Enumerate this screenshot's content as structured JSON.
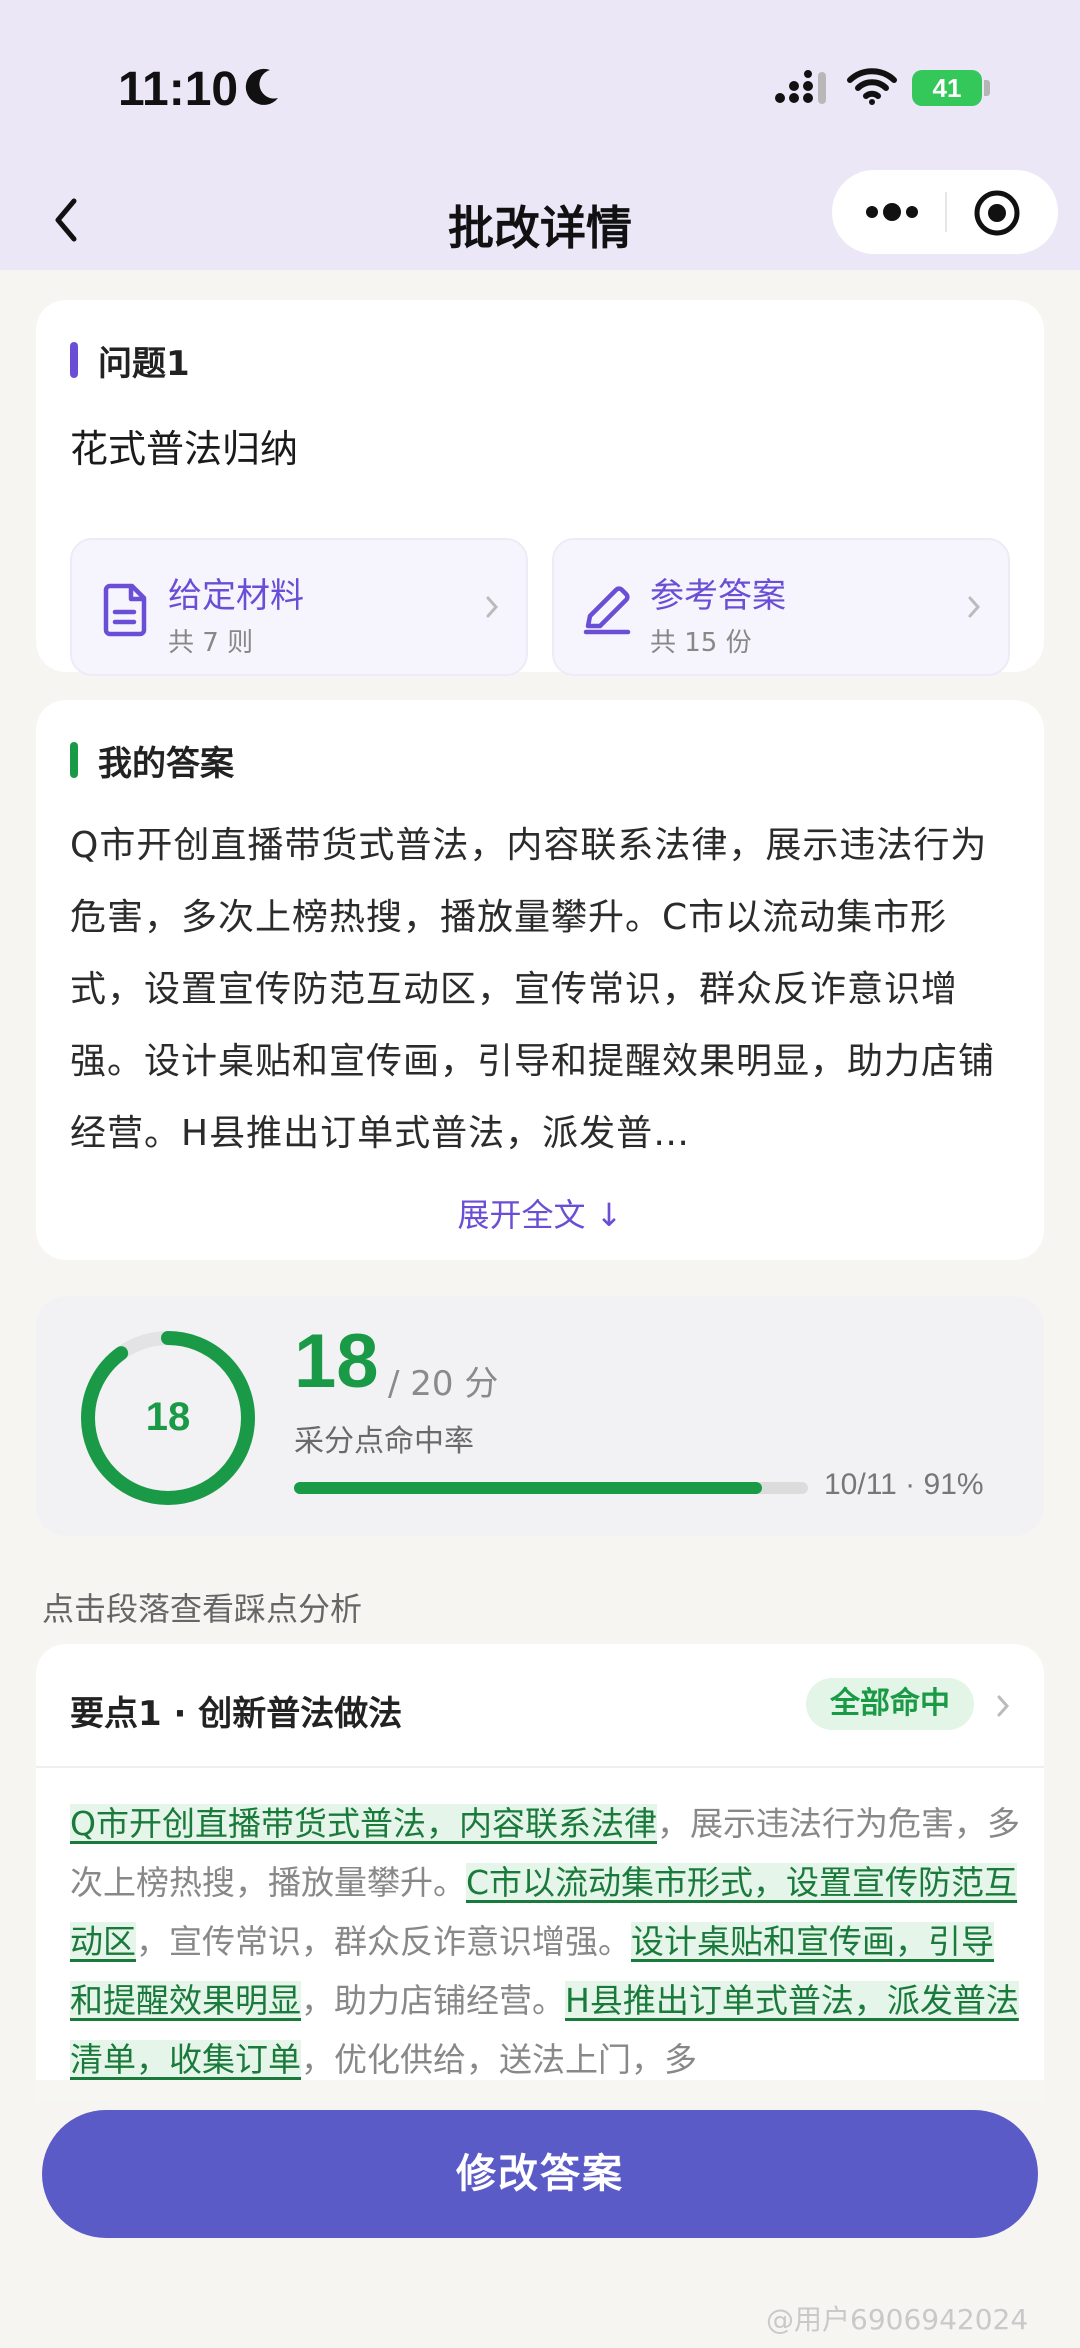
{
  "status_bar": {
    "time": "11:10",
    "battery": "41"
  },
  "nav": {
    "title": "批改详情"
  },
  "question": {
    "label": "问题1",
    "text": "花式普法归纳",
    "materials": {
      "title": "给定材料",
      "count": "共 7 则"
    },
    "reference": {
      "title": "参考答案",
      "count": "共 15 份"
    }
  },
  "my_answer": {
    "label": "我的答案",
    "text": "Q市开创直播带货式普法，内容联系法律，展示违法行为危害，多次上榜热搜，播放量攀升。C市以流动集市形式，设置宣传防范互动区，宣传常识，群众反诈意识增强。设计桌贴和宣传画，引导和提醒效果明显，助力店铺经营。H县推出订单式普法，派发普…",
    "expand": "展开全文 ↓"
  },
  "score": {
    "value": "18",
    "total": "/ 20 分",
    "label": "采分点命中率",
    "hit_fraction": 0.91,
    "score_fraction": 0.9,
    "progress_text": "10/11 · 91%",
    "color": "#1a9a46"
  },
  "hint": "点击段落查看踩点分析",
  "point": {
    "title": "要点1 · 创新普法做法",
    "badge": "全部命中",
    "segments": [
      {
        "text": "Q市开创直播带货式普法，内容联系法律",
        "hit": true
      },
      {
        "text": "，展示违法行为危害，多次上榜热搜，播放量攀升。",
        "hit": false
      },
      {
        "text": "C市以流动集市形式，设置宣传防范互动区",
        "hit": true
      },
      {
        "text": "，宣传常识，群众反诈意识增强。",
        "hit": false
      },
      {
        "text": "设计桌贴和宣传画，引导和提醒效果明显",
        "hit": true
      },
      {
        "text": "，助力店铺经营。",
        "hit": false
      },
      {
        "text": "H县推出订单式普法，派发普法清单，收集订单",
        "hit": true
      },
      {
        "text": "，优化供给，送法上门，多",
        "hit": false
      }
    ]
  },
  "actions": {
    "primary": "修改答案"
  },
  "watermark": "@用户6906942024"
}
